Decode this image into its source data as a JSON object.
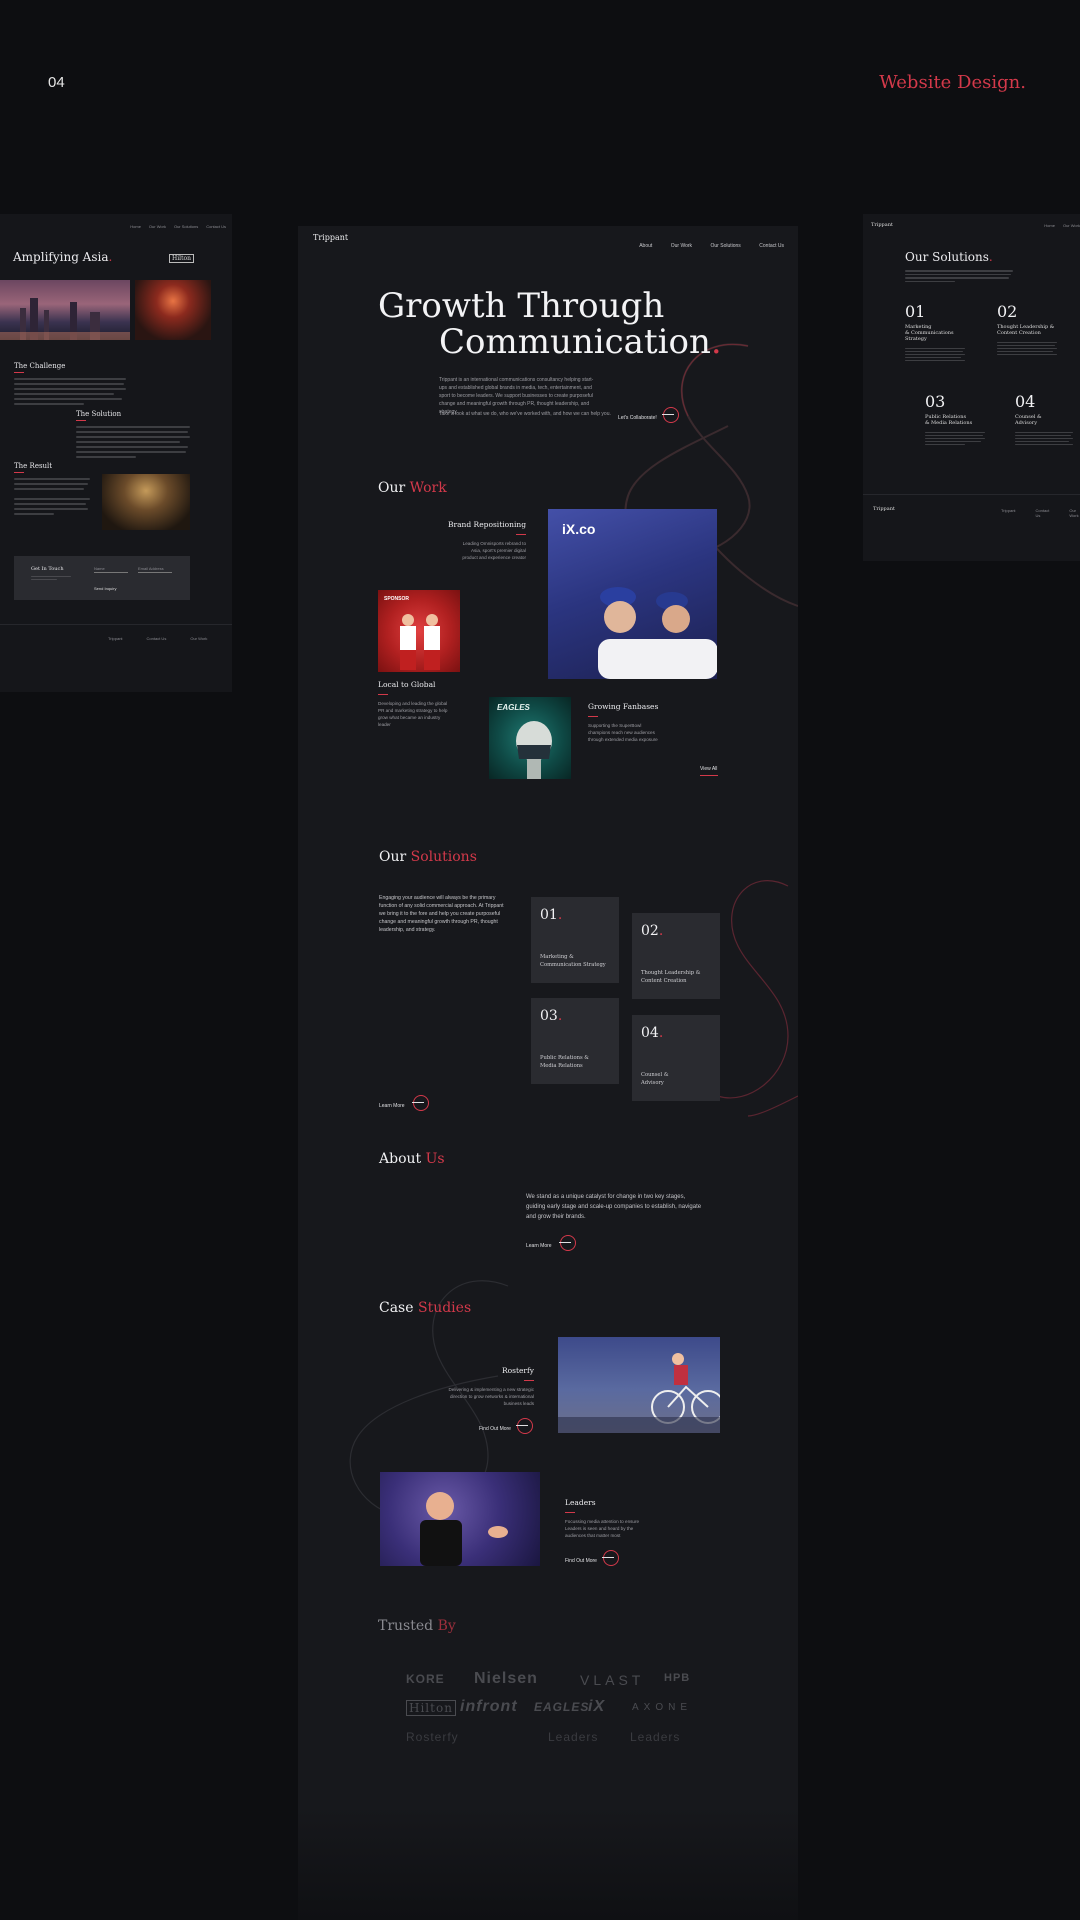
{
  "header": {
    "slide_number": "04",
    "title": "Website Design",
    "title_dot": "."
  },
  "left_panel": {
    "nav": [
      "Home",
      "Our Work",
      "Our Solutions",
      "Contact Us"
    ],
    "heading": "Amplifying Asia",
    "heading_dot": ".",
    "client_badge": "Hilton",
    "challenge_title": "The Challenge",
    "solution_title": "The Solution",
    "result_title": "The Result",
    "contact_title": "Get In Touch",
    "contact_fields": [
      "Name",
      "Email Address"
    ],
    "send_label": "Send Inquiry",
    "footer_cols": [
      "Trippant",
      "Contact Us",
      "Our Work"
    ]
  },
  "right_panel": {
    "brand": "Trippant",
    "nav": [
      "Home",
      "Our Work"
    ],
    "heading": "Our Solutions",
    "heading_dot": ".",
    "items": [
      {
        "num": "01",
        "label_lines": [
          "Marketing",
          "& Communications",
          "Strategy"
        ]
      },
      {
        "num": "02",
        "label_lines": [
          "Thought Leadership &",
          "Content Creation"
        ]
      },
      {
        "num": "03",
        "label_lines": [
          "Public Relations",
          "& Media Relations"
        ]
      },
      {
        "num": "04",
        "label_lines": [
          "Counsel &",
          "Advisory"
        ]
      }
    ],
    "footer_brand": "Trippant",
    "footer_cols": [
      "Trippant",
      "Contact Us",
      "Our Work"
    ]
  },
  "main": {
    "brand": "Trippant",
    "nav": [
      "About",
      "Our Work",
      "Our Solutions",
      "Contact Us"
    ],
    "hero_line1": "Growth Through",
    "hero_line2": "Communication",
    "hero_dot": ".",
    "hero_body": "Trippant is an international communications consultancy helping start-ups and established global brands in media, tech, entertainment, and sport to become leaders. We support businesses to create purposeful change and meaningful growth through PR, thought leadership, and strategy.",
    "hero_body2": "Take a look at what we do, who we've worked with, and how we can help you.",
    "hero_cta": "Let's Collaborate!",
    "work_title_a": "Our",
    "work_title_b": "Work",
    "work_items": [
      {
        "title": "Brand Repositioning",
        "desc": "Leading Omnisports rebrand to Asia, sport's premier digital product and experience creator"
      },
      {
        "title": "Local to Global",
        "desc": "Developing and leading the global PR and marketing strategy to help grow what became an industry leader"
      },
      {
        "title": "Growing Fanbases",
        "desc": "Supporting the SuperBowl champions reach new audiences through extended media exposure"
      }
    ],
    "ix_logo": "iX.co",
    "sponsor_logo": "SPONSOR",
    "eagles_logo": "EAGLES",
    "view_all": "View All",
    "solutions_title_a": "Our",
    "solutions_title_b": "Solutions",
    "solutions_body": "Engaging your audience will always be the primary function of any solid commercial approach. At Trippant we bring it to the fore and help you create purposeful change and meaningful growth through PR, thought leadership, and strategy.",
    "solutions": [
      {
        "num": "01",
        "dot": ".",
        "label_line1": "Marketing &",
        "label_line2": "Communication Strategy"
      },
      {
        "num": "02",
        "dot": ".",
        "label_line1": "Thought Leadership &",
        "label_line2": "Content Creation"
      },
      {
        "num": "03",
        "dot": ".",
        "label_line1": "Public Relations &",
        "label_line2": "Media Relations"
      },
      {
        "num": "04",
        "dot": ".",
        "label_line1": "Counsel &",
        "label_line2": "Advisory"
      }
    ],
    "solutions_cta": "Learn More",
    "about_title_a": "About",
    "about_title_b": "Us",
    "about_body": "We stand as a unique catalyst for change in two key stages, guiding early stage and scale-up companies to establish, navigate and grow their brands.",
    "about_cta": "Learn More",
    "case_title_a": "Case",
    "case_title_b": "Studies",
    "cases": [
      {
        "title": "Rosterfy",
        "desc": "Delivering & implementing a new strategic direction to grow networks & international business leads",
        "cta": "Find Out More"
      },
      {
        "title": "Leaders",
        "desc": "Focussing media attention to ensure Leaders is seen and heard by the audiences that matter most",
        "cta": "Find Out More"
      }
    ],
    "trusted_title_a": "Trusted",
    "trusted_title_b": "By",
    "trusted_logos": [
      "KORE",
      "Nielsen",
      "VLAST",
      "HPB",
      "Hilton",
      "infront",
      "EAGLES",
      "iX",
      "AXONE",
      "Rosterfy",
      "Leaders",
      "Leaders"
    ]
  }
}
